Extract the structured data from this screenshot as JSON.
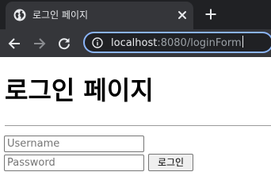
{
  "browser": {
    "tab": {
      "title": "로그인 페이지",
      "favicon": "globe-icon",
      "close_icon": "close-icon"
    },
    "new_tab_icon": "plus-icon",
    "toolbar": {
      "back_icon": "arrow-left-icon",
      "forward_icon": "arrow-right-icon",
      "reload_icon": "reload-icon",
      "info_icon": "info-icon"
    },
    "address_bar": {
      "host": "localhost",
      "rest": ":8080/loginForm"
    },
    "colors": {
      "tabstrip": "#202124",
      "toolbar": "#35363a",
      "omnibox_border": "#8ab4f8"
    }
  },
  "page": {
    "title": "로그인 페이지",
    "form": {
      "username": {
        "value": "",
        "placeholder": "Username"
      },
      "password": {
        "value": "",
        "placeholder": "Password"
      },
      "submit_label": "로그인"
    }
  }
}
